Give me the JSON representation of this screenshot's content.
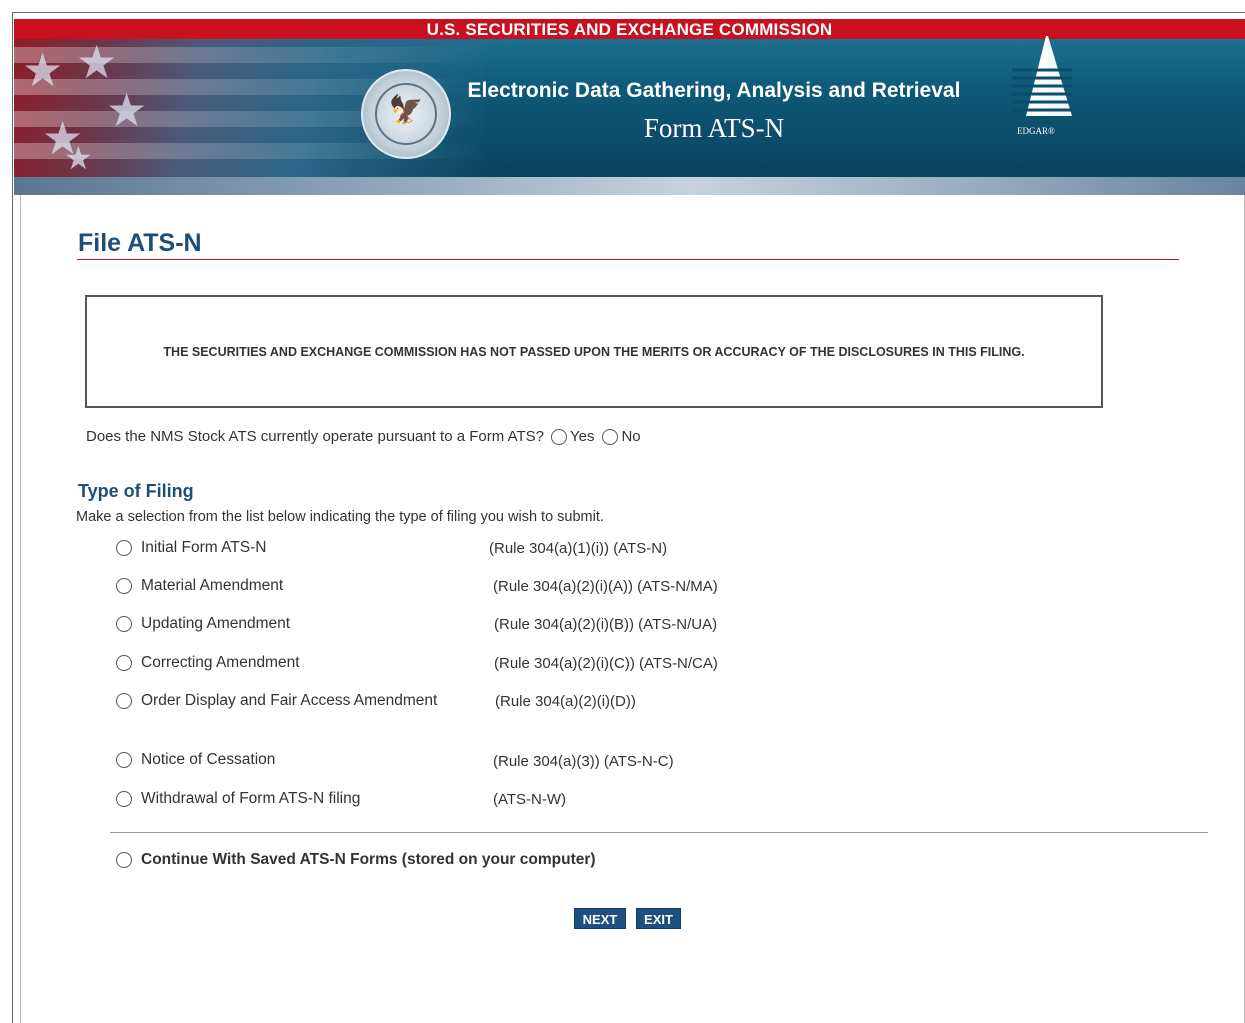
{
  "header": {
    "agency": "U.S. SECURITIES AND EXCHANGE COMMISSION",
    "system_title": "Electronic Data Gathering, Analysis and Retrieval",
    "form_name": "Form ATS-N",
    "logo_label": "EDGAR®"
  },
  "page": {
    "title": "File ATS-N",
    "disclaimer": "THE SECURITIES AND EXCHANGE COMMISSION HAS NOT PASSED UPON THE MERITS OR ACCURACY OF THE DISCLOSURES IN THIS FILING."
  },
  "question": {
    "text": "Does the NMS Stock ATS currently operate pursuant to a Form ATS?",
    "options": [
      "Yes",
      "No"
    ]
  },
  "filing": {
    "title": "Type of Filing",
    "description": "Make a selection from the list below indicating the type of filing you wish to submit.",
    "options": [
      {
        "label": "Initial Form ATS-N",
        "rule": "(Rule 304(a)(1)(i)) (ATS-N)"
      },
      {
        "label": "Material Amendment",
        "rule": "(Rule 304(a)(2)(i)(A)) (ATS-N/MA)"
      },
      {
        "label": "Updating Amendment",
        "rule": "(Rule 304(a)(2)(i)(B)) (ATS-N/UA)"
      },
      {
        "label": "Correcting Amendment",
        "rule": "(Rule 304(a)(2)(i)(C)) (ATS-N/CA)"
      },
      {
        "label": "Order Display and Fair Access Amendment",
        "rule": "(Rule 304(a)(2)(i)(D))"
      },
      {
        "label": "Notice of Cessation",
        "rule": "(Rule 304(a)(3)) (ATS-N-C)"
      },
      {
        "label": "Withdrawal of Form ATS-N filing",
        "rule": "(ATS-N-W)"
      }
    ],
    "continue_label": "Continue With Saved ATS-N Forms (stored on your computer)"
  },
  "buttons": {
    "next": "NEXT",
    "exit": "EXIT"
  },
  "colors": {
    "topbar": "#c8101e",
    "heading": "#1d4e7a",
    "title_rule": "#b21f24",
    "button": "#1e4f80"
  }
}
